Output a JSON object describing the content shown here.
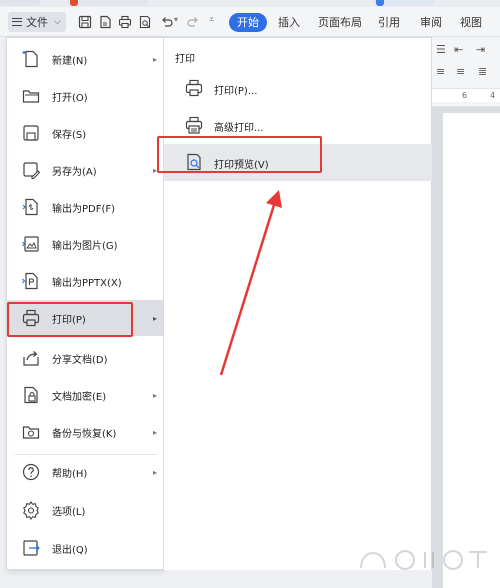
{
  "toolbar": {
    "file_label": "文件",
    "tabs": [
      "开始",
      "插入",
      "页面布局",
      "引用",
      "审阅",
      "视图"
    ]
  },
  "ruler": {
    "marks": [
      "6",
      "4"
    ]
  },
  "file_menu": {
    "items": [
      {
        "label": "新建(N)",
        "icon": "new-document-icon",
        "has_submenu": true
      },
      {
        "label": "打开(O)",
        "icon": "folder-open-icon",
        "has_submenu": false
      },
      {
        "label": "保存(S)",
        "icon": "save-icon",
        "has_submenu": false
      },
      {
        "label": "另存为(A)",
        "icon": "save-as-icon",
        "has_submenu": true
      },
      {
        "label": "输出为PDF(F)",
        "icon": "export-pdf-icon",
        "has_submenu": false
      },
      {
        "label": "输出为图片(G)",
        "icon": "export-image-icon",
        "has_submenu": false
      },
      {
        "label": "输出为PPTX(X)",
        "icon": "export-pptx-icon",
        "has_submenu": false
      },
      {
        "label": "打印(P)",
        "icon": "printer-icon",
        "has_submenu": true,
        "selected": true
      },
      {
        "label": "分享文档(D)",
        "icon": "share-icon",
        "has_submenu": false
      },
      {
        "label": "文档加密(E)",
        "icon": "encrypt-icon",
        "has_submenu": true
      },
      {
        "label": "备份与恢复(K)",
        "icon": "backup-icon",
        "has_submenu": true
      },
      {
        "label": "帮助(H)",
        "icon": "help-icon",
        "has_submenu": true
      },
      {
        "label": "选项(L)",
        "icon": "gear-icon",
        "has_submenu": false
      },
      {
        "label": "退出(Q)",
        "icon": "exit-icon",
        "has_submenu": false
      }
    ]
  },
  "print_submenu": {
    "title": "打印",
    "items": [
      {
        "label": "打印(P)...",
        "icon": "printer-icon"
      },
      {
        "label": "高级打印...",
        "icon": "advanced-print-icon"
      },
      {
        "label": "打印预览(V)",
        "icon": "print-preview-icon",
        "selected": true
      }
    ]
  },
  "colors": {
    "accent": "#2f6fe6",
    "annotation": "#e53935",
    "selected_bg": "#dcdee3"
  }
}
